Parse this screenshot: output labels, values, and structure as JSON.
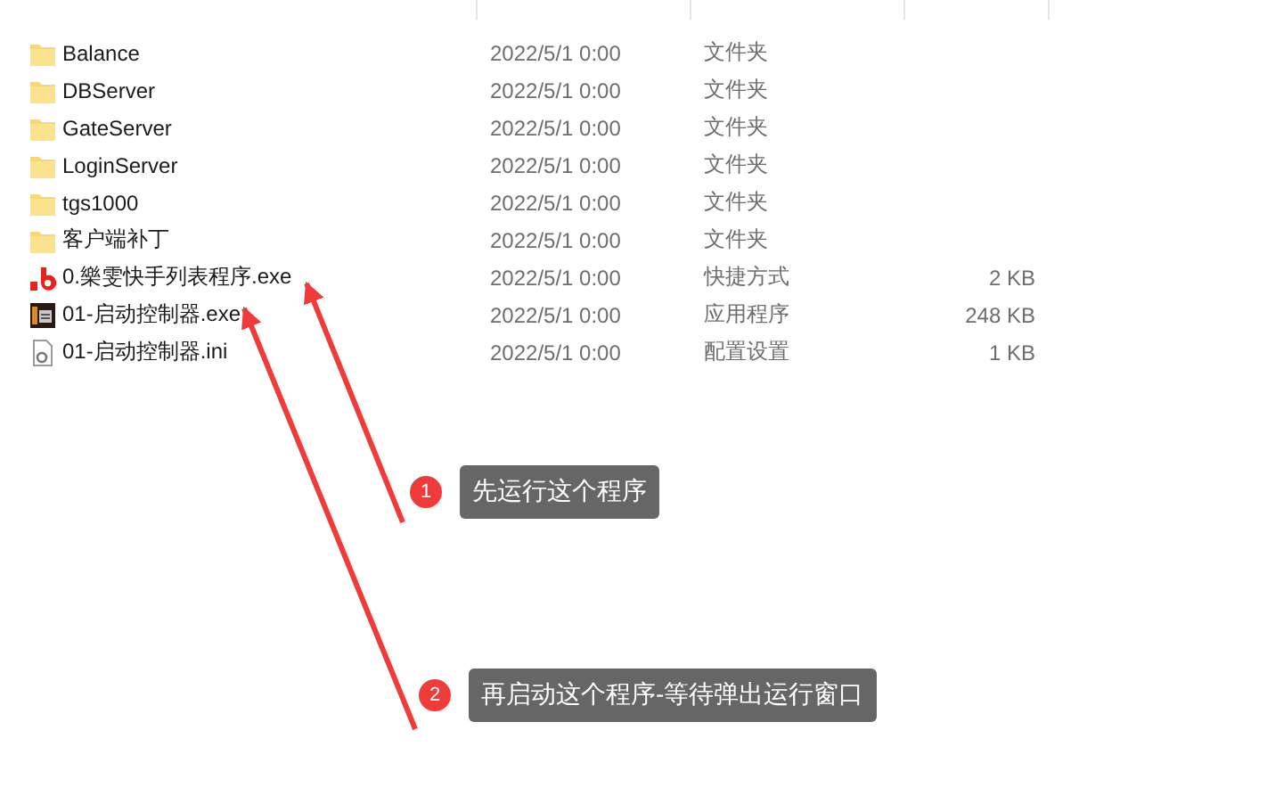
{
  "rows": [
    {
      "kind": "folder",
      "name": "Balance",
      "date": "2022/5/1 0:00",
      "type": "文件夹"
    },
    {
      "kind": "folder",
      "name": "DBServer",
      "date": "2022/5/1 0:00",
      "type": "文件夹"
    },
    {
      "kind": "folder",
      "name": "GateServer",
      "date": "2022/5/1 0:00",
      "type": "文件夹"
    },
    {
      "kind": "folder",
      "name": "LoginServer",
      "date": "2022/5/1 0:00",
      "type": "文件夹"
    },
    {
      "kind": "folder",
      "name": "tgs1000",
      "date": "2022/5/1 0:00",
      "type": "文件夹"
    },
    {
      "kind": "folder",
      "name": "客户端补丁",
      "date": "2022/5/1 0:00",
      "type": "文件夹"
    },
    {
      "kind": "shortcut",
      "name": "0.樂雯快手列表程序.exe",
      "date": "2022/5/1 0:00",
      "type": "快捷方式",
      "size": "2 KB"
    },
    {
      "kind": "app",
      "name": "01-启动控制器.exe",
      "date": "2022/5/1 0:00",
      "type": "应用程序",
      "size": "248 KB"
    },
    {
      "kind": "config",
      "name": "01-启动控制器.ini",
      "date": "2022/5/1 0:00",
      "type": "配置设置",
      "size": "1 KB"
    }
  ],
  "annotations": [
    {
      "number": "1",
      "text": "先运行这个程序"
    },
    {
      "number": "2",
      "text": "再启动这个程序-等待弹出运行窗口"
    }
  ]
}
